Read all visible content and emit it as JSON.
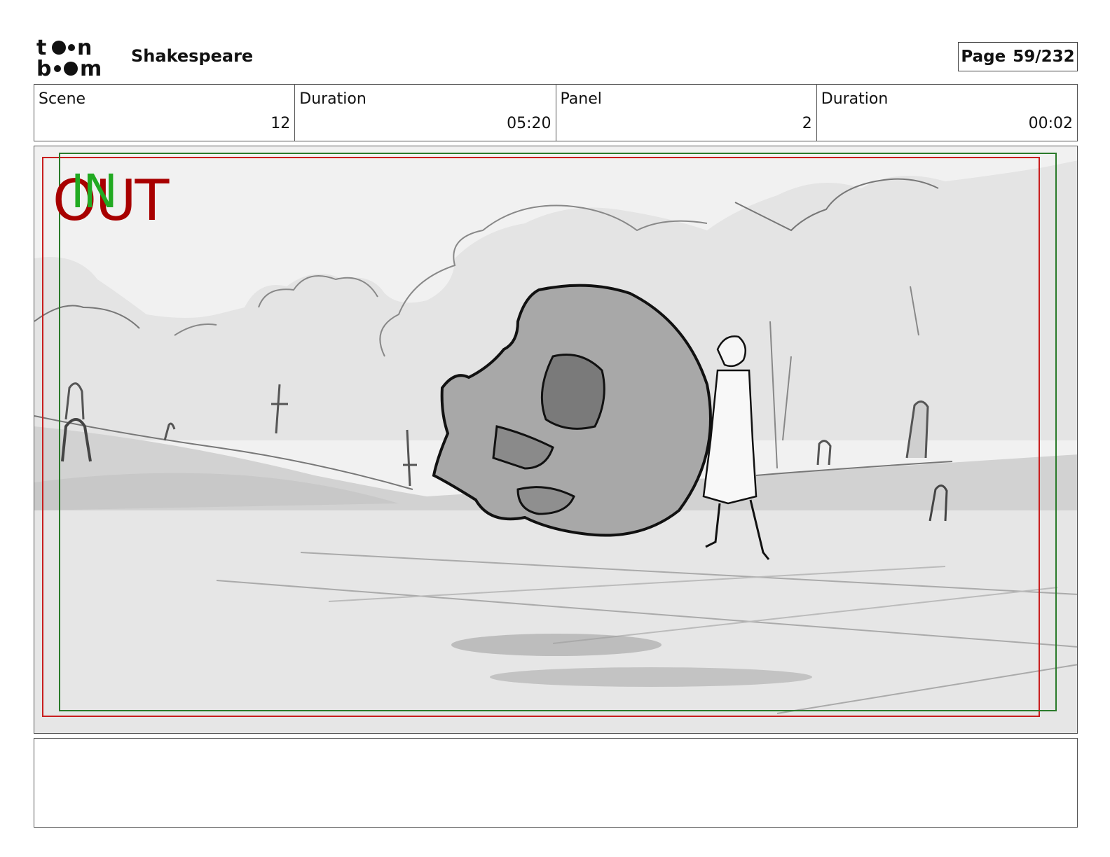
{
  "header": {
    "logo_text": "toon boom",
    "project_title": "Shakespeare",
    "page_label": "Page",
    "page_number": "59/232"
  },
  "info": [
    {
      "label": "Scene",
      "value": "12"
    },
    {
      "label": "Duration",
      "value": "05:20"
    },
    {
      "label": "Panel",
      "value": "2"
    },
    {
      "label": "Duration",
      "value": "00:02"
    }
  ],
  "panel": {
    "out_marker": "OUT",
    "in_marker": "IN",
    "colors": {
      "out_frame": "#c81e1e",
      "in_frame": "#2a7a2a"
    }
  },
  "notes": {
    "text": ""
  }
}
